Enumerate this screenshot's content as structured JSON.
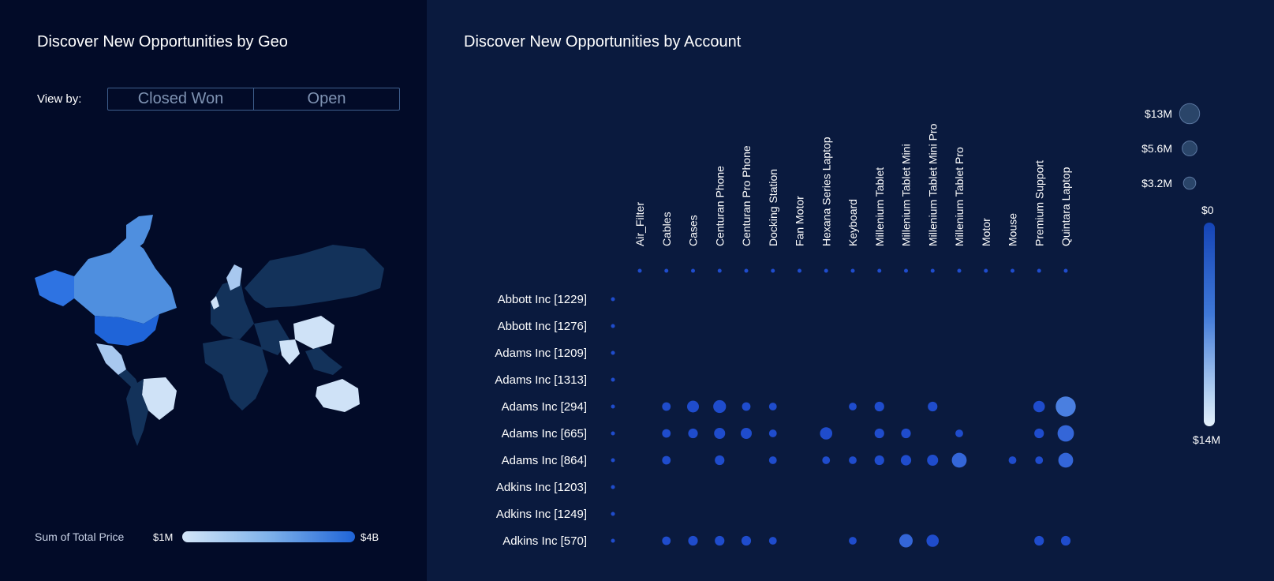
{
  "geo": {
    "title": "Discover New Opportunities by Geo",
    "view_by_label": "View by:",
    "toggle": [
      "Closed Won",
      "Open"
    ],
    "legend": {
      "label": "Sum of Total Price",
      "min": "$1M",
      "max": "$4B"
    }
  },
  "account": {
    "title": "Discover New Opportunities by Account",
    "products": [
      "Air_Filter",
      "Cables",
      "Cases",
      "Centuran Phone",
      "Centuran Pro Phone",
      "Docking Station",
      "Fan Motor",
      "Hexana Series Laptop",
      "Keyboard",
      "Millenium Tablet",
      "Millenium Tablet Mini",
      "Millenium Tablet Mini Pro",
      "Millenium Tablet Pro",
      "Motor",
      "Mouse",
      "Premium Support",
      "Quintara Laptop"
    ],
    "accounts": [
      "Abbott Inc [1229]",
      "Abbott Inc [1276]",
      "Adams Inc [1209]",
      "Adams Inc [1313]",
      "Adams Inc [294]",
      "Adams Inc [665]",
      "Adams Inc [864]",
      "Adkins Inc [1203]",
      "Adkins Inc [1249]",
      "Adkins Inc [570]"
    ],
    "size_legend": [
      "$13M",
      "$5.6M",
      "$3.2M"
    ],
    "color_scale": {
      "top": "$0",
      "bottom": "$14M"
    }
  },
  "chart_data": {
    "type": "scatter",
    "title": "Discover New Opportunities by Account",
    "x_categories": [
      "Air_Filter",
      "Cables",
      "Cases",
      "Centuran Phone",
      "Centuran Pro Phone",
      "Docking Station",
      "Fan Motor",
      "Hexana Series Laptop",
      "Keyboard",
      "Millenium Tablet",
      "Millenium Tablet Mini",
      "Millenium Tablet Mini Pro",
      "Millenium Tablet Pro",
      "Motor",
      "Mouse",
      "Premium Support",
      "Quintara Laptop"
    ],
    "y_categories": [
      "Abbott Inc [1229]",
      "Abbott Inc [1276]",
      "Adams Inc [1209]",
      "Adams Inc [1313]",
      "Adams Inc [294]",
      "Adams Inc [665]",
      "Adams Inc [864]",
      "Adkins Inc [1203]",
      "Adkins Inc [1249]",
      "Adkins Inc [570]"
    ],
    "size_legend_values_millions": [
      13,
      5.6,
      3.2
    ],
    "color_range": [
      "$0",
      "$14M"
    ],
    "points": [
      {
        "row": 4,
        "col": 1,
        "value": 0.8
      },
      {
        "row": 4,
        "col": 2,
        "value": 2.8
      },
      {
        "row": 4,
        "col": 3,
        "value": 3.6
      },
      {
        "row": 4,
        "col": 4,
        "value": 0.8
      },
      {
        "row": 4,
        "col": 5,
        "value": 0.5
      },
      {
        "row": 4,
        "col": 8,
        "value": 0.5
      },
      {
        "row": 4,
        "col": 9,
        "value": 1.3
      },
      {
        "row": 4,
        "col": 11,
        "value": 1.3
      },
      {
        "row": 4,
        "col": 15,
        "value": 2.5
      },
      {
        "row": 4,
        "col": 16,
        "value": 13
      },
      {
        "row": 5,
        "col": 1,
        "value": 0.8
      },
      {
        "row": 5,
        "col": 2,
        "value": 1.3
      },
      {
        "row": 5,
        "col": 3,
        "value": 2.2
      },
      {
        "row": 5,
        "col": 4,
        "value": 2.2
      },
      {
        "row": 5,
        "col": 5,
        "value": 0.5
      },
      {
        "row": 5,
        "col": 7,
        "value": 3.2
      },
      {
        "row": 5,
        "col": 9,
        "value": 1.3
      },
      {
        "row": 5,
        "col": 10,
        "value": 1.3
      },
      {
        "row": 5,
        "col": 12,
        "value": 0.5
      },
      {
        "row": 5,
        "col": 15,
        "value": 1.3
      },
      {
        "row": 5,
        "col": 16,
        "value": 7.5
      },
      {
        "row": 6,
        "col": 1,
        "value": 0.8
      },
      {
        "row": 6,
        "col": 3,
        "value": 1.3
      },
      {
        "row": 6,
        "col": 5,
        "value": 0.5
      },
      {
        "row": 6,
        "col": 7,
        "value": 0.5
      },
      {
        "row": 6,
        "col": 8,
        "value": 0.5
      },
      {
        "row": 6,
        "col": 9,
        "value": 1.3
      },
      {
        "row": 6,
        "col": 10,
        "value": 1.8
      },
      {
        "row": 6,
        "col": 11,
        "value": 2.2
      },
      {
        "row": 6,
        "col": 12,
        "value": 5.6
      },
      {
        "row": 6,
        "col": 14,
        "value": 0.5
      },
      {
        "row": 6,
        "col": 15,
        "value": 0.5
      },
      {
        "row": 6,
        "col": 16,
        "value": 5.6
      },
      {
        "row": 9,
        "col": 1,
        "value": 0.8
      },
      {
        "row": 9,
        "col": 2,
        "value": 1.3
      },
      {
        "row": 9,
        "col": 3,
        "value": 1.3
      },
      {
        "row": 9,
        "col": 4,
        "value": 1.3
      },
      {
        "row": 9,
        "col": 5,
        "value": 0.5
      },
      {
        "row": 9,
        "col": 8,
        "value": 0.5
      },
      {
        "row": 9,
        "col": 10,
        "value": 4.2
      },
      {
        "row": 9,
        "col": 11,
        "value": 3.2
      },
      {
        "row": 9,
        "col": 15,
        "value": 1.3
      },
      {
        "row": 9,
        "col": 16,
        "value": 1.3
      }
    ]
  }
}
